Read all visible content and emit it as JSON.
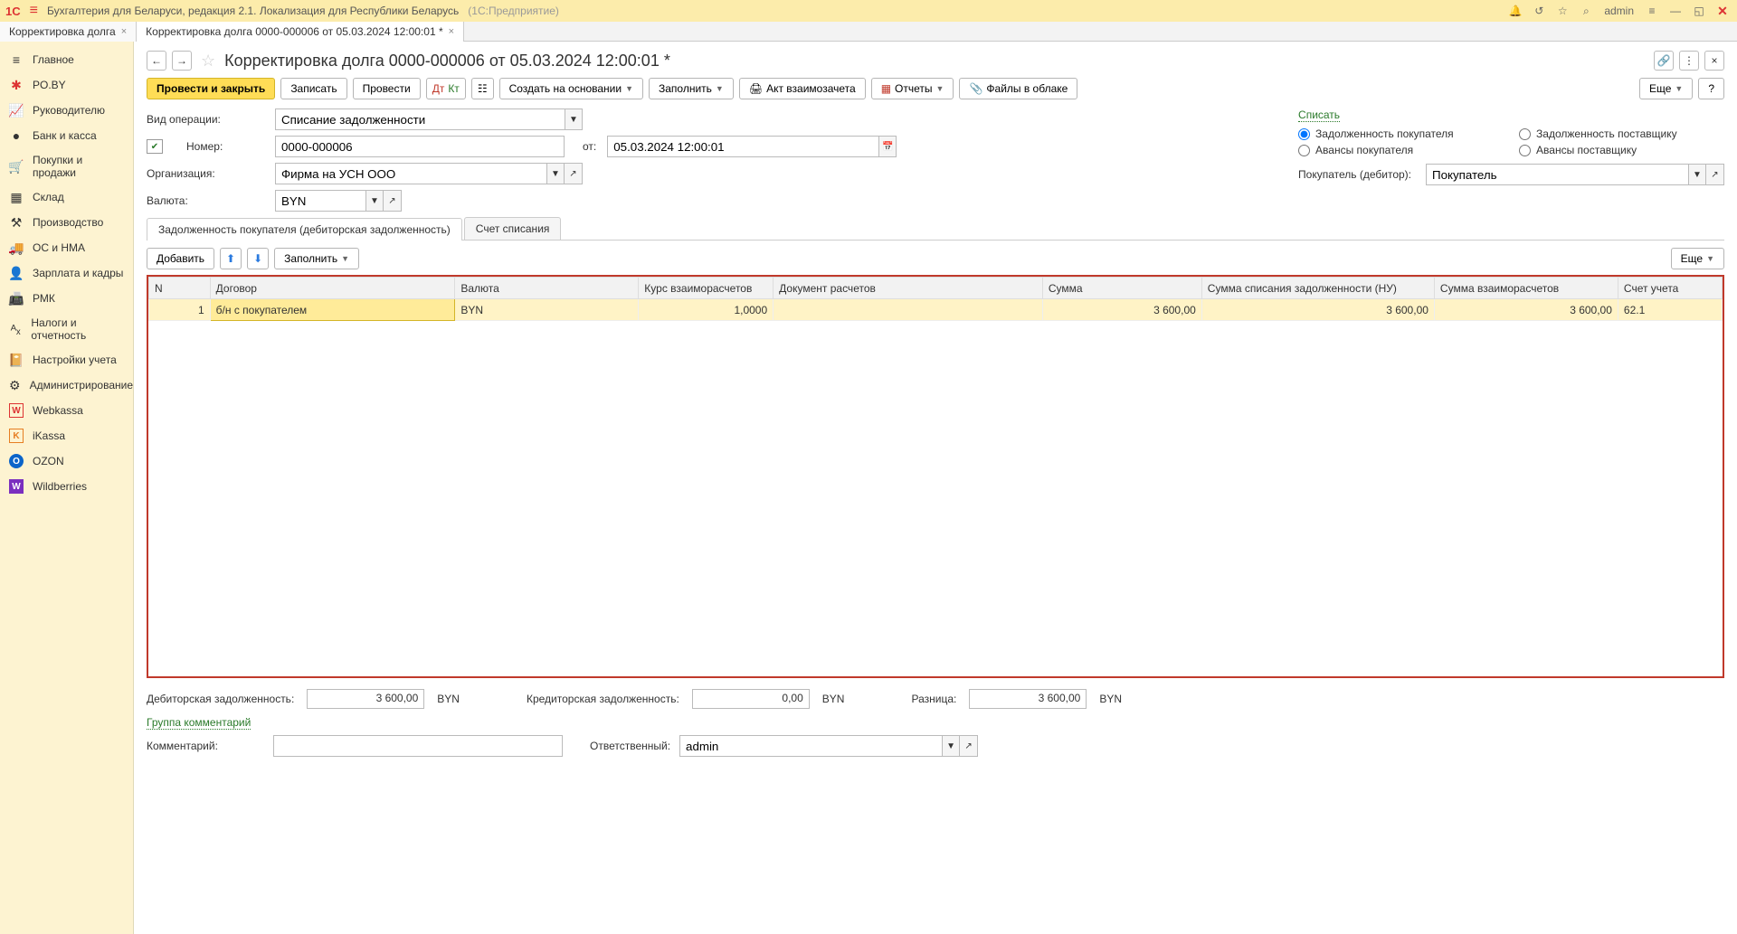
{
  "appbar": {
    "logo": "1C",
    "title": "Бухгалтерия для Беларуси, редакция 2.1. Локализация для Республики Беларусь",
    "subtitle": "(1С:Предприятие)",
    "user": "admin"
  },
  "tabs": [
    {
      "label": "Корректировка долга"
    },
    {
      "label": "Корректировка долга 0000-000006 от 05.03.2024 12:00:01 *",
      "active": true
    }
  ],
  "sidebar": [
    {
      "icon": "≡",
      "label": "Главное"
    },
    {
      "icon": "✱",
      "color": "#d33",
      "label": "PO.BY"
    },
    {
      "icon": "📈",
      "label": "Руководителю"
    },
    {
      "icon": "●",
      "label": "Банк и касса"
    },
    {
      "icon": "🛒",
      "label": "Покупки и продажи"
    },
    {
      "icon": "▦",
      "label": "Склад"
    },
    {
      "icon": "⚒",
      "label": "Производство"
    },
    {
      "icon": "🚚",
      "label": "ОС и НМА"
    },
    {
      "icon": "👤",
      "label": "Зарплата и кадры"
    },
    {
      "icon": "📠",
      "label": "РМК"
    },
    {
      "icon": "ᴬₓ",
      "label": "Налоги и отчетность"
    },
    {
      "icon": "📔",
      "label": "Настройки учета"
    },
    {
      "icon": "⚙",
      "label": "Администрирование"
    },
    {
      "icon": "W",
      "color": "#d33",
      "label": "Webkassa"
    },
    {
      "icon": "K",
      "color": "#e67e22",
      "label": "iKassa"
    },
    {
      "icon": "O",
      "color": "#0b64c9",
      "label": "OZON"
    },
    {
      "icon": "W",
      "color": "#7b2fbf",
      "label": "Wildberries"
    }
  ],
  "page": {
    "title": "Корректировка долга 0000-000006 от 05.03.2024 12:00:01 *"
  },
  "actions": {
    "post_close": "Провести и закрыть",
    "save": "Записать",
    "post": "Провести",
    "create_based": "Создать на основании",
    "fill": "Заполнить",
    "offset_act": "Акт взаимозачета",
    "reports": "Отчеты",
    "cloud_files": "Файлы в облаке",
    "more": "Еще",
    "help": "?"
  },
  "form": {
    "operation_label": "Вид операции:",
    "operation_value": "Списание задолженности",
    "number_label": "Номер:",
    "number_value": "0000-000006",
    "from_label": "от:",
    "date_value": "05.03.2024 12:00:01",
    "org_label": "Организация:",
    "org_value": "Фирма на УСН ООО",
    "currency_label": "Валюта:",
    "currency_value": "BYN",
    "writeoff_group": "Списать",
    "radio": {
      "a": "Задолженность покупателя",
      "b": "Задолженность поставщику",
      "c": "Авансы покупателя",
      "d": "Авансы поставщику"
    },
    "buyer_label": "Покупатель (дебитор):",
    "buyer_value": "Покупатель"
  },
  "inner_tabs": {
    "a": "Задолженность покупателя (дебиторская задолженность)",
    "b": "Счет списания"
  },
  "table_toolbar": {
    "add": "Добавить",
    "fill": "Заполнить",
    "more": "Еще"
  },
  "grid": {
    "headers": {
      "n": "N",
      "contract": "Договор",
      "currency": "Валюта",
      "rate": "Курс взаиморасчетов",
      "doc": "Документ расчетов",
      "sum": "Сумма",
      "sum_nu": "Сумма списания задолженности (НУ)",
      "sum_settle": "Сумма взаиморасчетов",
      "account": "Счет учета"
    },
    "rows": [
      {
        "n": "1",
        "contract": "б/н с покупателем",
        "currency": "BYN",
        "rate": "1,0000",
        "doc": "",
        "sum": "3 600,00",
        "sum_nu": "3 600,00",
        "sum_settle": "3 600,00",
        "account": "62.1"
      }
    ]
  },
  "footer": {
    "receivable_label": "Дебиторская задолженность:",
    "receivable_value": "3 600,00",
    "receivable_cur": "BYN",
    "payable_label": "Кредиторская задолженность:",
    "payable_value": "0,00",
    "payable_cur": "BYN",
    "diff_label": "Разница:",
    "diff_value": "3 600,00",
    "diff_cur": "BYN",
    "comments_group": "Группа комментарий",
    "comment_label": "Комментарий:",
    "responsible_label": "Ответственный:",
    "responsible_value": "admin"
  }
}
